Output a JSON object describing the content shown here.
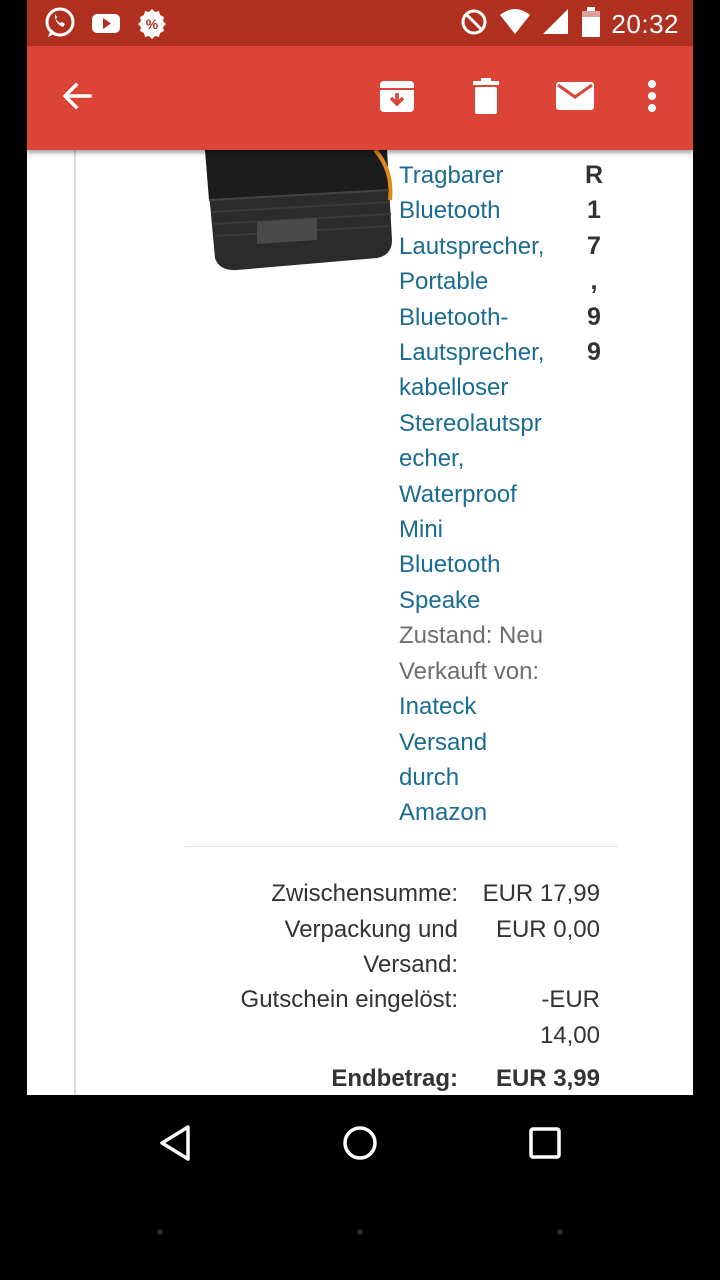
{
  "status_bar": {
    "time": "20:32",
    "left_icons": [
      "whatsapp-icon",
      "youtube-icon",
      "discount-app-icon"
    ],
    "right_icons": [
      "do-not-disturb-icon",
      "wifi-icon",
      "cell-signal-icon",
      "battery-icon"
    ]
  },
  "toolbar": {
    "back_icon": "arrow-left-icon",
    "actions": [
      "archive-icon",
      "delete-icon",
      "mark-unread-icon",
      "more-vert-icon"
    ]
  },
  "email": {
    "product_title_lines": [
      "Tragbarer",
      "Bluetooth",
      "Lautsprecher,",
      "Portable",
      "Bluetooth-",
      "Lautsprecher,",
      "kabelloser",
      "Stereolautspr",
      "echer,",
      "Waterproof",
      "Mini",
      "Bluetooth",
      "Speake"
    ],
    "condition": "Zustand: Neu",
    "sold_by_label": "Verkauft von:",
    "seller": "Inateck",
    "shipping_lines": [
      "Versand",
      "durch",
      "Amazon"
    ],
    "price_chars": [
      "R",
      "1",
      "7",
      ",",
      "9",
      "9"
    ],
    "summary": {
      "subtotal_label": "Zwischensumme:",
      "subtotal_value": "EUR 17,99",
      "shipping_label_line1": "Verpackung und",
      "shipping_label_line2": "Versand:",
      "shipping_value": "EUR 0,00",
      "coupon_label": "Gutschein eingelöst:",
      "coupon_value_line1": "-EUR",
      "coupon_value_line2": "14,00",
      "total_label": "Endbetrag:",
      "total_value": "EUR 3,99"
    }
  },
  "colors": {
    "toolbar": "#db4437",
    "status_bar": "#b0301f",
    "link": "#1a6c92",
    "text": "#333333"
  }
}
